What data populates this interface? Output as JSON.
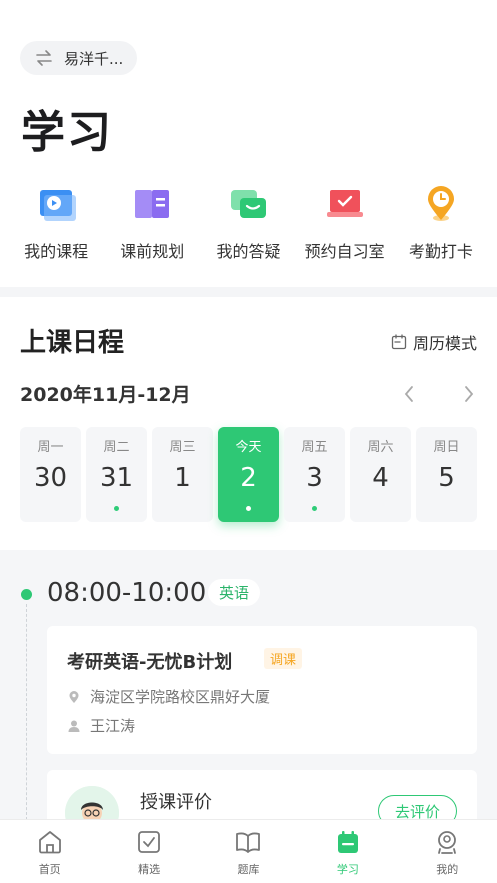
{
  "switcher": {
    "label": "易洋千...",
    "icon": "swap-icon"
  },
  "page_title": "学习",
  "quick_actions": [
    {
      "label": "我的课程",
      "icon": "video-course-icon",
      "color": "#3b8ff3"
    },
    {
      "label": "课前规划",
      "icon": "book-plan-icon",
      "color": "#8b6cf0"
    },
    {
      "label": "我的答疑",
      "icon": "chat-bubbles-icon",
      "color": "#2ec875"
    },
    {
      "label": "预约自习室",
      "icon": "laptop-check-icon",
      "color": "#f0515b"
    },
    {
      "label": "考勤打卡",
      "icon": "clock-pin-icon",
      "color": "#f5a623"
    }
  ],
  "schedule": {
    "title": "上课日程",
    "mode_label": "周历模式",
    "month_range": "2020年11月-12月",
    "days": [
      {
        "name": "周一",
        "date": "30",
        "has_class": false,
        "active": false
      },
      {
        "name": "周二",
        "date": "31",
        "has_class": true,
        "active": false
      },
      {
        "name": "周三",
        "date": "1",
        "has_class": false,
        "active": false
      },
      {
        "name": "今天",
        "date": "2",
        "has_class": true,
        "active": true
      },
      {
        "name": "周五",
        "date": "3",
        "has_class": true,
        "active": false
      },
      {
        "name": "周六",
        "date": "4",
        "has_class": false,
        "active": false
      },
      {
        "name": "周日",
        "date": "5",
        "has_class": false,
        "active": false
      }
    ]
  },
  "lesson": {
    "time": "08:00-10:00",
    "subject": "英语",
    "title": "考研英语-无忧B计划",
    "tag": "调课",
    "location": "海淀区学院路校区鼎好大厦",
    "teacher": "王江涛"
  },
  "evaluation": {
    "title": "授课评价",
    "button": "去评价"
  },
  "tabbar": [
    {
      "label": "首页",
      "icon": "home-icon",
      "active": false
    },
    {
      "label": "精选",
      "icon": "check-square-icon",
      "active": false
    },
    {
      "label": "题库",
      "icon": "open-book-icon",
      "active": false
    },
    {
      "label": "学习",
      "icon": "calendar-icon",
      "active": true
    },
    {
      "label": "我的",
      "icon": "user-badge-icon",
      "active": false
    }
  ],
  "colors": {
    "accent": "#2ec875",
    "tag_orange": "#f5a623"
  }
}
